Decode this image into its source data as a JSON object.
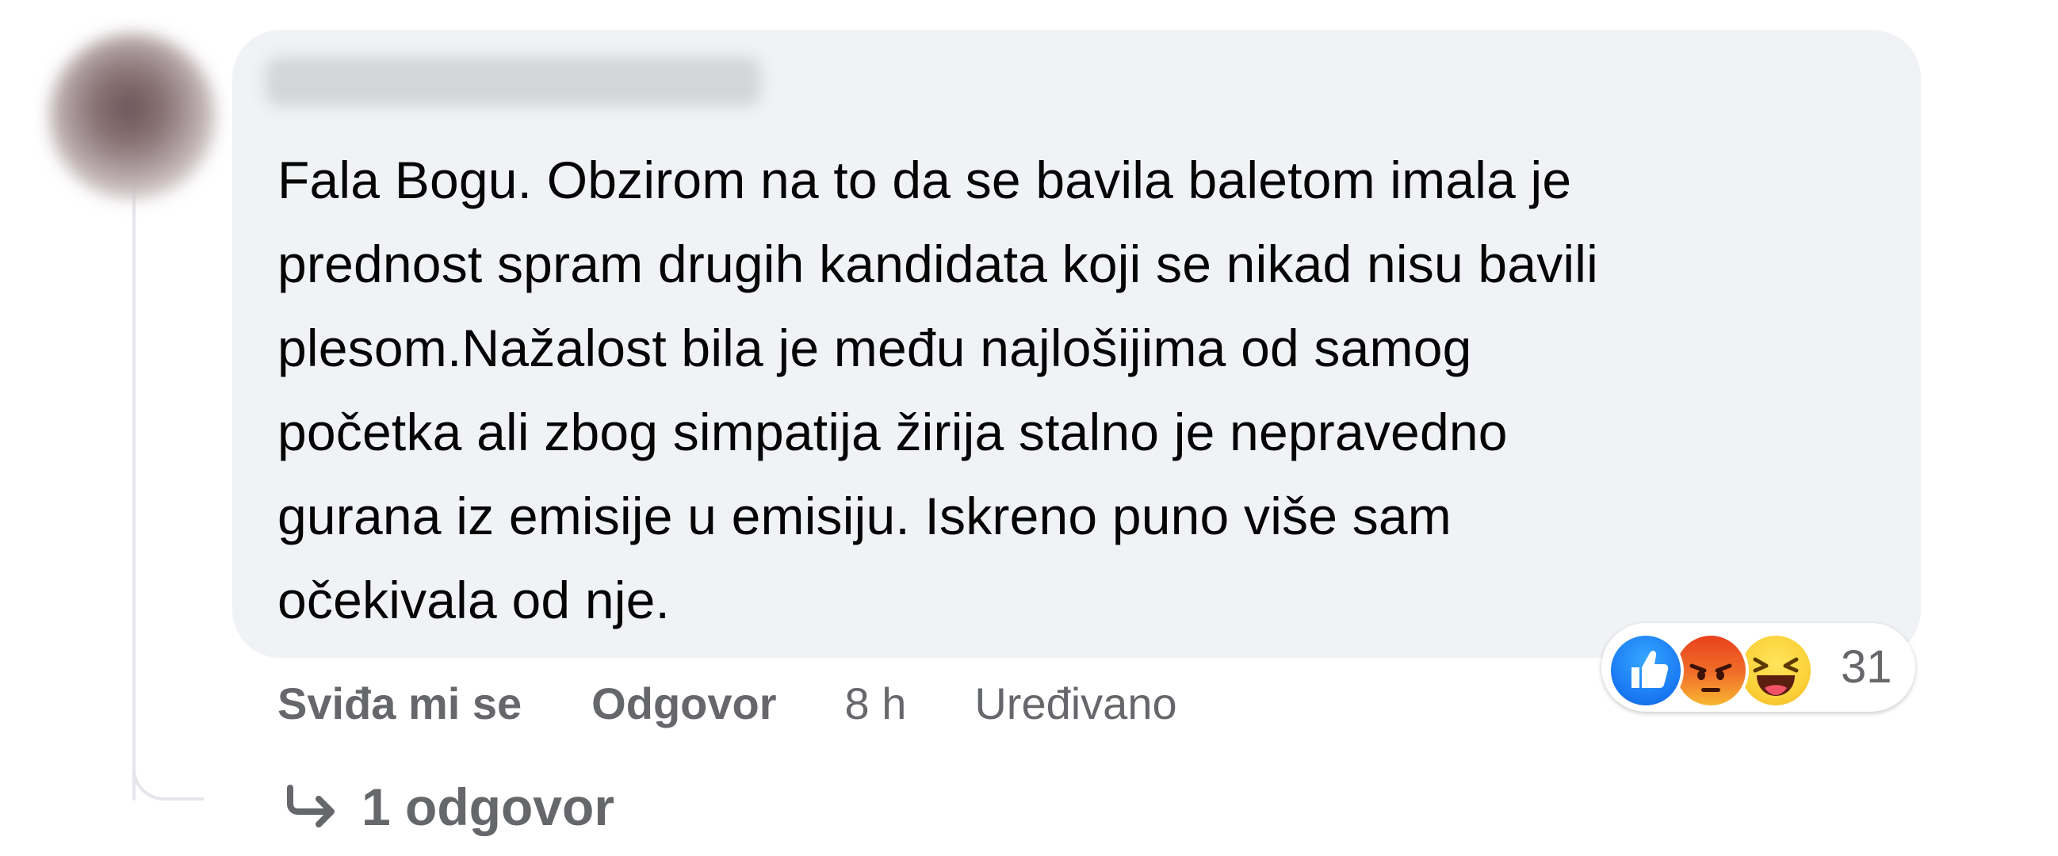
{
  "comment": {
    "text_lines": [
      "Fala Bogu. Obzirom na to da se bavila baletom imala je",
      "prednost spram drugih kandidata koji se nikad nisu bavili",
      "plesom.Nažalost bila je među najlošijima od samog",
      "početka ali zbog simpatija žirija stalno je nepravedno",
      "gurana iz emisije u emisiju. Iskreno puno više sam",
      "očekivala od nje."
    ],
    "reactions": {
      "icons": [
        "like-icon",
        "angry-icon",
        "haha-icon"
      ],
      "count": "31"
    },
    "actions": {
      "like_label": "Sviđa mi se",
      "reply_label": "Odgovor",
      "time": "8 h",
      "edited_label": "Uređivano"
    },
    "replies": {
      "label": "1 odgovor"
    }
  },
  "colors": {
    "bubble_background": "#f0f2f5",
    "secondary_text": "#65676b",
    "primary_text": "#050505",
    "like_blue": "#1877f2",
    "thread_line": "#e4e6eb"
  }
}
